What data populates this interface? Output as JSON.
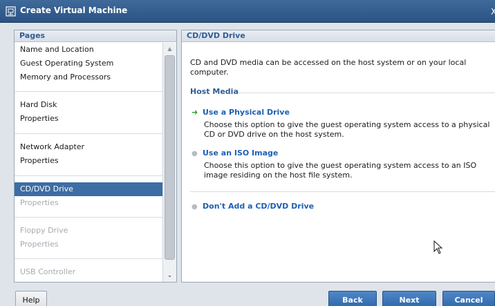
{
  "window": {
    "title": "Create Virtual Machine",
    "app_icon": "vm-icon",
    "close_glyph": "X"
  },
  "pages_panel": {
    "header": "Pages",
    "items": [
      {
        "label": "Name and Location",
        "state": "normal"
      },
      {
        "label": "Guest Operating System",
        "state": "normal"
      },
      {
        "label": "Memory and Processors",
        "state": "normal"
      },
      {
        "label": "Hard Disk",
        "state": "normal"
      },
      {
        "label": "Properties",
        "state": "normal"
      },
      {
        "label": "Network Adapter",
        "state": "normal"
      },
      {
        "label": "Properties",
        "state": "normal"
      },
      {
        "label": "CD/DVD Drive",
        "state": "selected"
      },
      {
        "label": "Properties",
        "state": "disabled"
      },
      {
        "label": "Floppy Drive",
        "state": "disabled"
      },
      {
        "label": "Properties",
        "state": "disabled"
      },
      {
        "label": "USB Controller",
        "state": "disabled"
      }
    ]
  },
  "content": {
    "header": "CD/DVD Drive",
    "description": "CD and DVD media can be accessed on the host system or on your local computer.",
    "section_title": "Host Media",
    "options": [
      {
        "label": "Use a Physical Drive",
        "description": "Choose this option to give the guest operating system access to a physical CD or DVD drive on the host system.",
        "selected": true
      },
      {
        "label": "Use an ISO Image",
        "description": "Choose this option to give the guest operating system access to an ISO image residing on the host file system.",
        "selected": false
      }
    ],
    "extra_option": {
      "label": "Don't Add a CD/DVD Drive"
    }
  },
  "buttons": {
    "help": "Help",
    "back": "Back",
    "next": "Next",
    "cancel": "Cancel"
  },
  "colors": {
    "accent": "#3d6da3",
    "link": "#1f5fb5",
    "arrow": "#2aa12a"
  }
}
